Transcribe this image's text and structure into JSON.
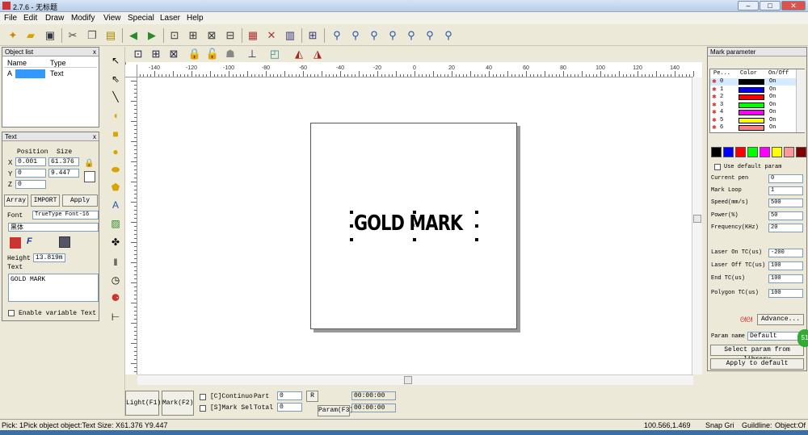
{
  "app": {
    "title": "2.7.6 - 无标题"
  },
  "window_buttons": {
    "min": "–",
    "max": "□",
    "close": "✕"
  },
  "menu": [
    "File",
    "Edit",
    "Draw",
    "Modify",
    "View",
    "Special",
    "Laser",
    "Help"
  ],
  "object_list": {
    "title": "Object list",
    "close": "x",
    "columns": [
      "Name",
      "Type"
    ],
    "rows": [
      {
        "name": "A",
        "type": "Text"
      }
    ]
  },
  "text_panel": {
    "title": "Text",
    "close": "x",
    "position_label": "Position",
    "size_label": "Size",
    "x_label": "X",
    "y_label": "Y",
    "z_label": "Z",
    "x_pos": "0.001",
    "y_pos": "0",
    "z_pos": "0",
    "x_size": "61.376",
    "y_size": "9.447",
    "array_btn": "Array",
    "import_btn": "IMPORT",
    "apply_btn": "Apply",
    "font_label": "Font",
    "font_type": "TrueType Font-16",
    "font_name": "黑体",
    "height_label": "Height",
    "height_value": "13.819m",
    "text_label": "Text",
    "text_value": "GOLD MARK",
    "enable_variable": "Enable variable Text"
  },
  "canvas": {
    "ruler_labels": [
      "-140",
      "-120",
      "-100",
      "-80",
      "-60",
      "-40",
      "-20",
      "0",
      "20",
      "40",
      "60",
      "80",
      "100",
      "120",
      "140"
    ],
    "mark_text": "GOLD MARK",
    "center_mark": "×"
  },
  "bottom": {
    "light_btn": "Light(F1)",
    "mark_btn": "Mark(F2)",
    "continuous": "[C]Continuo",
    "part_label": "Part",
    "part_value": "0",
    "r_btn": "R",
    "time1": "00:00:00",
    "mark_sel": "[S]Mark Sel",
    "total_label": "Total",
    "total_value": "0",
    "param_btn": "Param(F3)",
    "time2": "00:00:00"
  },
  "mark_param": {
    "title": "Mark parameter",
    "columns": [
      "Pe...",
      "Color",
      "On/Off"
    ],
    "pens": [
      {
        "id": "0",
        "color": "#000000",
        "state": "On"
      },
      {
        "id": "1",
        "color": "#0000ff",
        "state": "On"
      },
      {
        "id": "2",
        "color": "#ff0000",
        "state": "On"
      },
      {
        "id": "3",
        "color": "#00ff00",
        "state": "On"
      },
      {
        "id": "4",
        "color": "#ff00ff",
        "state": "On"
      },
      {
        "id": "5",
        "color": "#ffff00",
        "state": "On"
      },
      {
        "id": "6",
        "color": "#ff8080",
        "state": "On"
      }
    ],
    "palette": [
      "#000000",
      "#0000ff",
      "#ff0000",
      "#00ff00",
      "#ff00ff",
      "#ffff00",
      "#ff9999",
      "#800000"
    ],
    "use_default": "Use default param",
    "fields": [
      {
        "label": "Current pen",
        "value": "0"
      },
      {
        "label": "Mark Loop",
        "value": "1"
      },
      {
        "label": "Speed(mm/s)",
        "value": "500"
      },
      {
        "label": "Power(%)",
        "value": "50"
      },
      {
        "label": "Frequency(KHz)",
        "value": "20"
      },
      {
        "label": "Laser On TC(us)",
        "value": "-200"
      },
      {
        "label": "Laser Off TC(us)",
        "value": "100"
      },
      {
        "label": "End TC(us)",
        "value": "100"
      },
      {
        "label": "Polygon TC(us)",
        "value": "100"
      }
    ],
    "advance_btn": "Advance...",
    "param_name_label": "Param name",
    "param_name_value": "Default",
    "select_library_btn": "Select param from library",
    "apply_default_btn": "Apply to default",
    "badge": "51"
  },
  "status": {
    "message": "Pick: 1Pick object object:Text Size: X61.376 Y9.447",
    "coords": "100.566,1.469",
    "snap": "Snap Gri",
    "guideline": "Guildline:",
    "object": "Object:Of"
  }
}
